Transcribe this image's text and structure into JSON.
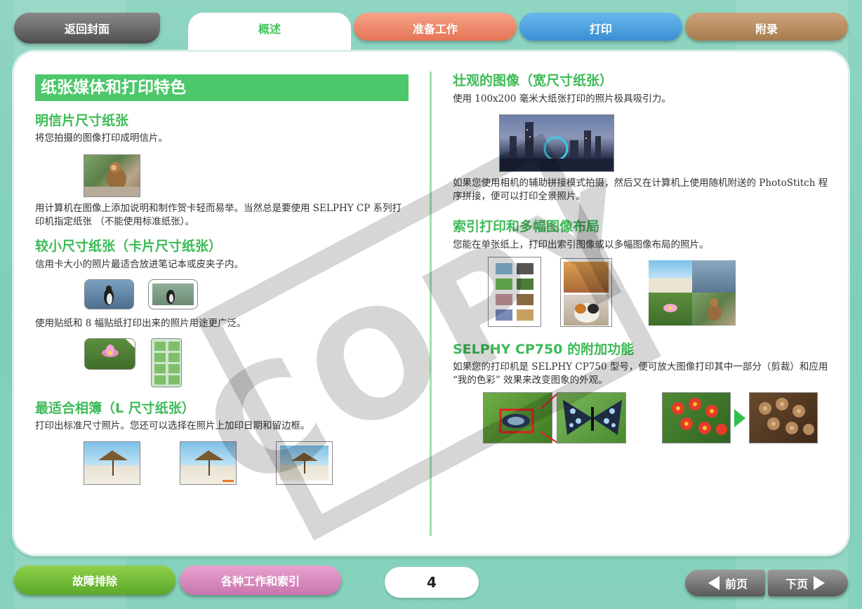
{
  "nav": {
    "home": "返回封面",
    "overview": "概述",
    "prep": "准备工作",
    "print": "打印",
    "appendix": "附录"
  },
  "left": {
    "section_title": "纸张媒体和打印特色",
    "postcard": {
      "heading": "明信片尺寸纸张",
      "text1": "将您拍摄的图像打印成明信片。",
      "text2": "用计算机在图像上添加说明和制作贺卡轻而易举。当然总是要使用 SELPHY CP 系列打印机指定纸张 （不能使用标准纸张）。"
    },
    "card": {
      "heading": "较小尺寸纸张（卡片尺寸纸张）",
      "text1": "信用卡大小的照片最适合放进笔记本或皮夹子内。",
      "text2": "使用贴纸和 8 幅贴纸打印出来的照片用途更广泛。"
    },
    "album": {
      "heading": "最适合相簿（L 尺寸纸张）",
      "text1": "打印出标准尺寸照片。您还可以选择在照片上加印日期和留边框。"
    }
  },
  "right": {
    "wide": {
      "heading": "壮观的图像（宽尺寸纸张）",
      "text1": "使用 100x200 毫米大纸张打印的照片极具吸引力。",
      "text2": "如果您使用相机的辅助拼接模式拍摄，然后又在计算机上使用随机附送的 PhotoStitch 程序拼接，便可以打印全景照片。"
    },
    "index": {
      "heading": "索引打印和多幅图像布局",
      "text1": "您能在单张纸上，打印出索引图像或以多幅图像布局的照片。"
    },
    "cp750": {
      "heading": "SELPHY CP750 的附加功能",
      "text1": "如果您的打印机是 SELPHY CP750 型号，便可放大图像打印其中一部分（剪裁）和应用 “我的色彩” 效果来改变图象的外观。"
    }
  },
  "bottom": {
    "trouble": "故障排除",
    "index": "各种工作和索引",
    "page": "4",
    "prev": "前页",
    "next": "下页"
  },
  "watermark": "COPY"
}
